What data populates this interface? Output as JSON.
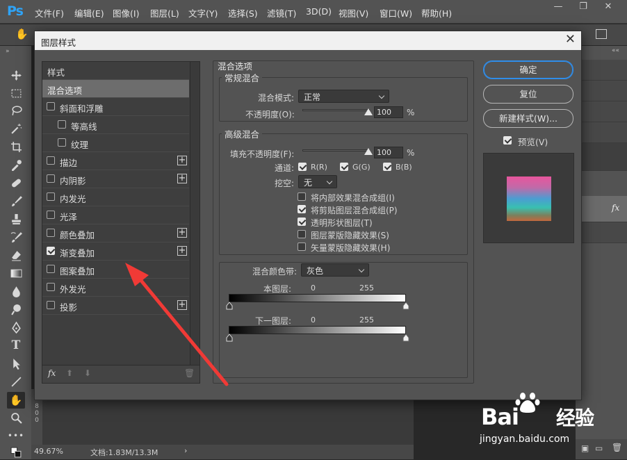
{
  "app": {
    "logo": "Ps",
    "menu": [
      "文件(F)",
      "编辑(E)",
      "图像(I)",
      "图层(L)",
      "文字(Y)",
      "选择(S)",
      "滤镜(T)",
      "3D(D)",
      "视图(V)",
      "窗口(W)",
      "帮助(H)"
    ],
    "status": {
      "zoom": "49.67%",
      "doc": "文档:1.83M/13.3M"
    },
    "ruler_digits": [
      "8",
      "0",
      "0"
    ],
    "panel_fx": "fx"
  },
  "dialog": {
    "title": "图层样式",
    "styles_header": "样式",
    "blend_options": "混合选项",
    "items": [
      {
        "label": "斜面和浮雕",
        "checked": false,
        "plus": false,
        "indent": false
      },
      {
        "label": "等高线",
        "checked": false,
        "plus": false,
        "indent": true
      },
      {
        "label": "纹理",
        "checked": false,
        "plus": false,
        "indent": true
      },
      {
        "label": "描边",
        "checked": false,
        "plus": true,
        "indent": false
      },
      {
        "label": "内阴影",
        "checked": false,
        "plus": true,
        "indent": false
      },
      {
        "label": "内发光",
        "checked": false,
        "plus": false,
        "indent": false
      },
      {
        "label": "光泽",
        "checked": false,
        "plus": false,
        "indent": false
      },
      {
        "label": "颜色叠加",
        "checked": false,
        "plus": true,
        "indent": false
      },
      {
        "label": "渐变叠加",
        "checked": true,
        "plus": true,
        "indent": false
      },
      {
        "label": "图案叠加",
        "checked": false,
        "plus": false,
        "indent": false
      },
      {
        "label": "外发光",
        "checked": false,
        "plus": false,
        "indent": false
      },
      {
        "label": "投影",
        "checked": false,
        "plus": true,
        "indent": false
      }
    ],
    "fx_label": "fx",
    "section_title": "混合选项",
    "general": {
      "legend": "常规混合",
      "mode_label": "混合模式:",
      "mode_value": "正常",
      "opacity_label": "不透明度(O):",
      "opacity_value": "100",
      "opacity_unit": "%"
    },
    "advanced": {
      "legend": "高级混合",
      "fill_label": "填充不透明度(F):",
      "fill_value": "100",
      "fill_unit": "%",
      "channels_label": "通道:",
      "channels": [
        "R(R)",
        "G(G)",
        "B(B)"
      ],
      "knockout_label": "挖空:",
      "knockout_value": "无",
      "options": [
        {
          "label": "将内部效果混合成组(I)",
          "checked": false
        },
        {
          "label": "将剪贴图层混合成组(P)",
          "checked": true
        },
        {
          "label": "透明形状图层(T)",
          "checked": true
        },
        {
          "label": "图层蒙版隐藏效果(S)",
          "checked": false
        },
        {
          "label": "矢量蒙版隐藏效果(H)",
          "checked": false
        }
      ]
    },
    "blend_if": {
      "label": "混合颜色带:",
      "value": "灰色",
      "this_layer": "本图层:",
      "underlying": "下一图层:",
      "min": "0",
      "max": "255"
    },
    "buttons": {
      "ok": "确定",
      "reset": "复位",
      "new_style": "新建样式(W)...",
      "preview": "预览(V)"
    },
    "preview_checked": true
  },
  "watermark": {
    "brand": "Bai",
    "brand_cn": "经验",
    "url": "jingyan.baidu.com"
  },
  "colors": {
    "ps_blue": "#2fa3f6",
    "accent_blue": "#2f8dea",
    "arrow_red": "#f03a36"
  }
}
